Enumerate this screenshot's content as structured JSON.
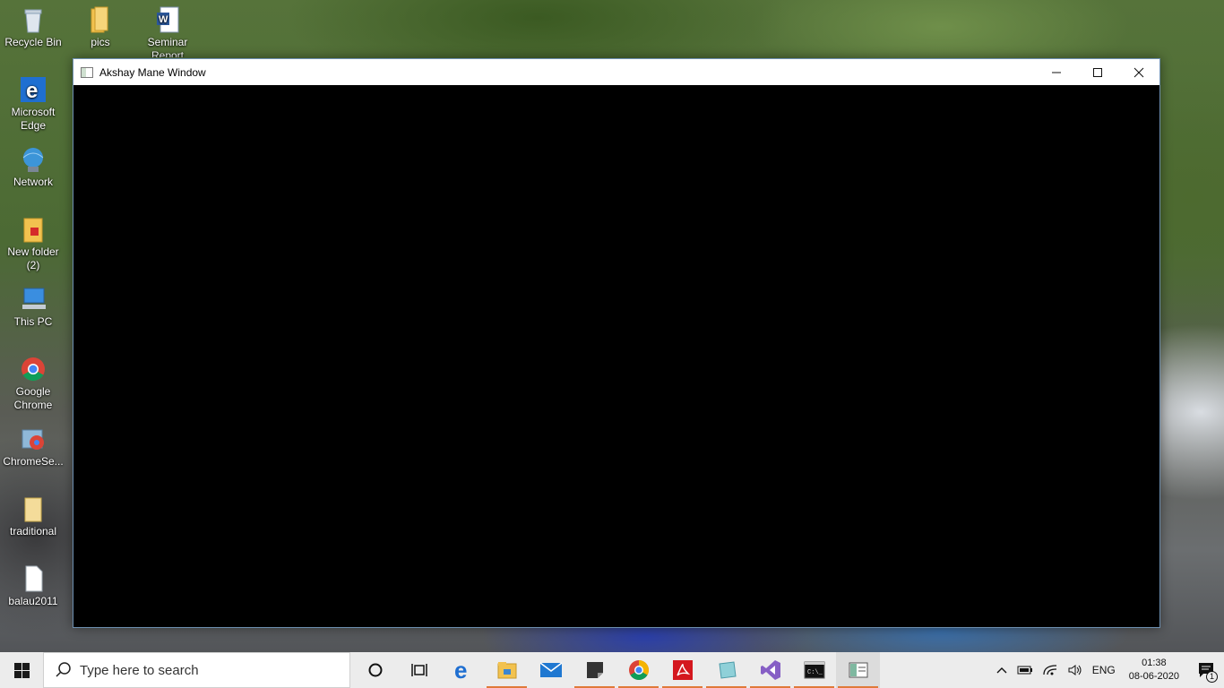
{
  "desktop": {
    "icons": [
      {
        "label": "Recycle Bin",
        "icon": "recycle-bin-icon"
      },
      {
        "label": "pics",
        "icon": "folder-icon"
      },
      {
        "label": "Seminar Report",
        "icon": "word-document-icon"
      },
      {
        "label": "Microsoft Edge",
        "icon": "edge-icon"
      },
      {
        "label": "Network",
        "icon": "network-icon"
      },
      {
        "label": "New folder (2)",
        "icon": "folder-icon"
      },
      {
        "label": "This PC",
        "icon": "computer-icon"
      },
      {
        "label": "Google Chrome",
        "icon": "chrome-icon"
      },
      {
        "label": "ChromeSe...",
        "icon": "chrome-setup-icon"
      },
      {
        "label": "traditional",
        "icon": "folder-icon"
      },
      {
        "label": "balau2011",
        "icon": "file-icon"
      }
    ]
  },
  "window": {
    "title": "Akshay Mane Window",
    "minimize": "—",
    "maximize": "☐",
    "close": "✕"
  },
  "taskbar": {
    "search_placeholder": "Type here to search",
    "apps": [
      "cortana",
      "task-view",
      "edge",
      "file-explorer",
      "mail",
      "sticky-notes",
      "chrome",
      "acrobat",
      "notepad-app",
      "visual-studio",
      "cmd",
      "akshay-window"
    ],
    "tray": {
      "language": "ENG",
      "time": "01:38",
      "date": "08-06-2020",
      "notification_count": "1"
    }
  }
}
